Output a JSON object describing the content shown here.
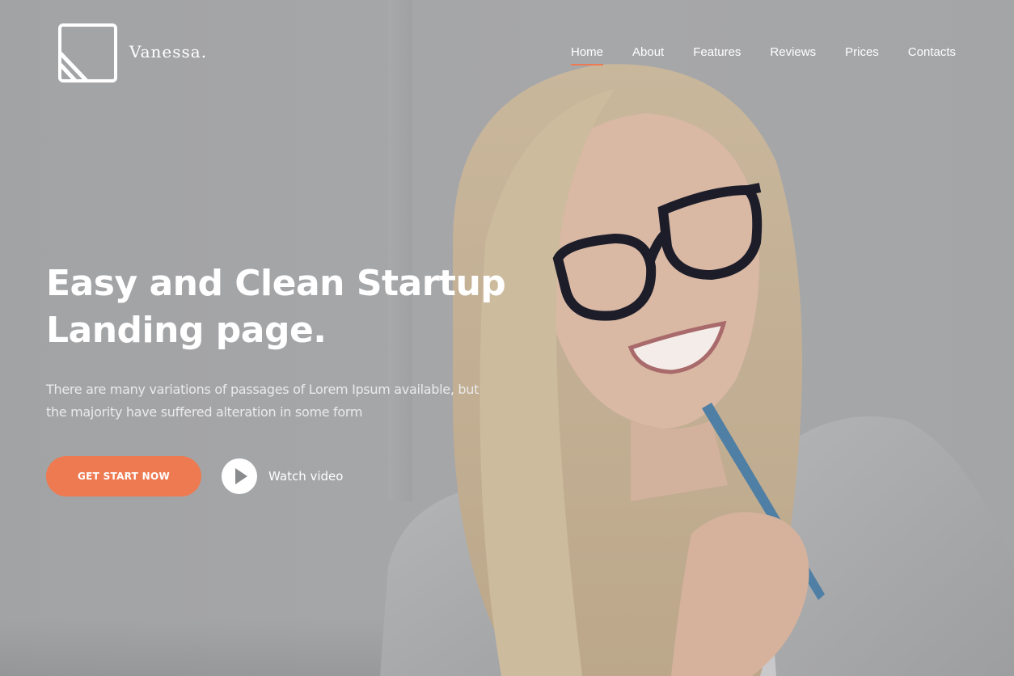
{
  "brand": {
    "name": "Vanessa.",
    "logo_icon": "diagonal-stripes-square-icon"
  },
  "nav": {
    "items": [
      {
        "label": "Home",
        "active": true
      },
      {
        "label": "About",
        "active": false
      },
      {
        "label": "Features",
        "active": false
      },
      {
        "label": "Reviews",
        "active": false
      },
      {
        "label": "Prices",
        "active": false
      },
      {
        "label": "Contacts",
        "active": false
      }
    ]
  },
  "hero": {
    "title_line1": "Easy and Clean Startup",
    "title_line2": "Landing page.",
    "description_line1": "There are many variations of passages of Lorem Ipsum available, but",
    "description_line2": "the majority have suffered alteration in some form",
    "primary_button": "GET START NOW",
    "video_link": "Watch video",
    "video_icon": "play-icon",
    "background_image": "smiling woman with glasses holding a pen"
  },
  "colors": {
    "accent": "#ee7a52",
    "overlay": "#a3a4a6",
    "text": "#ffffff"
  }
}
